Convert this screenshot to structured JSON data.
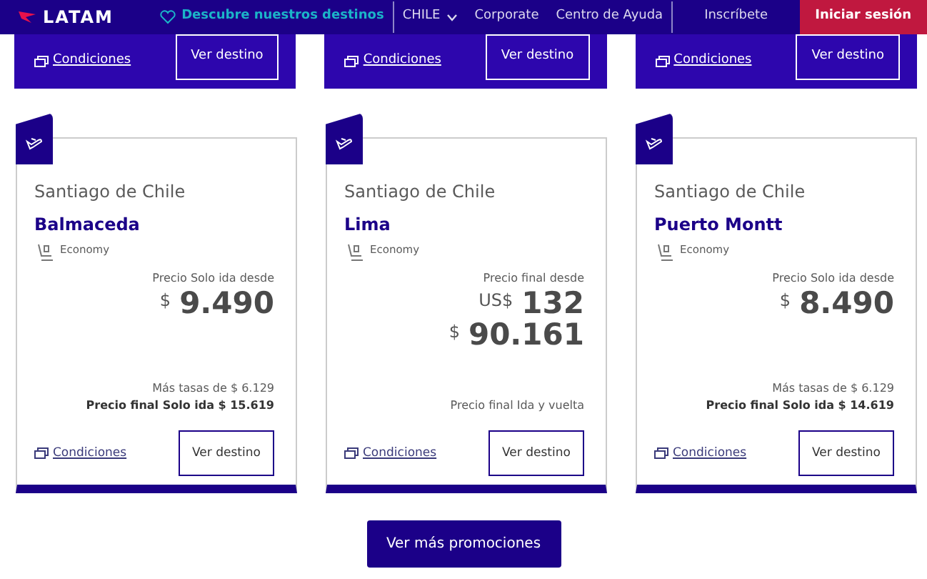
{
  "navbar": {
    "brand": "LATAM",
    "discover": "Descubre nuestros destinos",
    "country": "CHILE",
    "links": [
      "Corporate",
      "Centro de Ayuda"
    ],
    "signup": "Inscríbete",
    "login": "Iniciar sesión"
  },
  "top_cards": [
    {
      "conditions": "Condiciones",
      "button": "Ver destino"
    },
    {
      "conditions": "Condiciones",
      "button": "Ver destino"
    },
    {
      "conditions": "Condiciones",
      "button": "Ver destino"
    }
  ],
  "cards": [
    {
      "origin": "Santiago de Chile",
      "destination": "Balmaceda",
      "cabin": "Economy",
      "price_label": "Precio Solo ida desde",
      "amounts": [
        {
          "currency": "$",
          "amount": "9.490"
        }
      ],
      "notes": [
        {
          "kind": "light",
          "text": "Más tasas de $ 6.129"
        },
        {
          "kind": "bold",
          "text": "Precio final Solo ida $ 15.619"
        }
      ],
      "conditions": "Condiciones",
      "button": "Ver destino"
    },
    {
      "origin": "Santiago de Chile",
      "destination": "Lima",
      "cabin": "Economy",
      "price_label": "Precio final desde",
      "amounts": [
        {
          "currency": "US$",
          "amount": "132"
        },
        {
          "currency": "$",
          "amount": "90.161"
        }
      ],
      "notes": [
        {
          "kind": "light",
          "text": "Precio final Ida y vuelta"
        }
      ],
      "conditions": "Condiciones",
      "button": "Ver destino"
    },
    {
      "origin": "Santiago de Chile",
      "destination": "Puerto Montt",
      "cabin": "Economy",
      "price_label": "Precio Solo ida desde",
      "amounts": [
        {
          "currency": "$",
          "amount": "8.490"
        }
      ],
      "notes": [
        {
          "kind": "light",
          "text": "Más tasas de $ 6.129"
        },
        {
          "kind": "bold",
          "text": "Precio final Solo ida $ 14.619"
        }
      ],
      "conditions": "Condiciones",
      "button": "Ver destino"
    }
  ],
  "more_button": "Ver más promociones"
}
